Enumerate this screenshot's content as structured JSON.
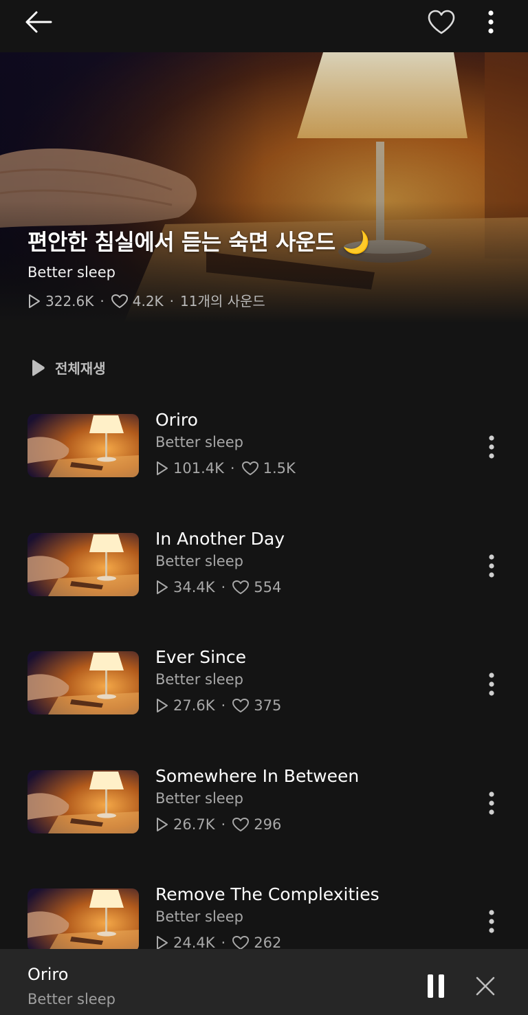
{
  "header": {
    "back_icon": "arrow-left-icon",
    "favorite_icon": "heart-outline-icon",
    "more_icon": "more-vertical-icon"
  },
  "playlist": {
    "title": "편안한 침실에서 듣는 숙면 사운드",
    "title_emoji": "🌙",
    "artist": "Better sleep",
    "plays": "322.6K",
    "likes": "4.2K",
    "separator": "·",
    "sound_count": "11개의 사운드"
  },
  "play_all": {
    "label": "전체재생",
    "icon": "play-icon"
  },
  "tracks": [
    {
      "title": "Oriro",
      "artist": "Better sleep",
      "plays": "101.4K",
      "likes": "1.5K"
    },
    {
      "title": "In Another Day",
      "artist": "Better sleep",
      "plays": "34.4K",
      "likes": "554"
    },
    {
      "title": "Ever Since",
      "artist": "Better sleep",
      "plays": "27.6K",
      "likes": "375"
    },
    {
      "title": "Somewhere In Between",
      "artist": "Better sleep",
      "plays": "26.7K",
      "likes": "296"
    },
    {
      "title": "Remove The Complexities",
      "artist": "Better sleep",
      "plays": "24.4K",
      "likes": "262"
    }
  ],
  "mini_player": {
    "title": "Oriro",
    "artist": "Better sleep",
    "pause_icon": "pause-icon",
    "close_icon": "close-icon"
  },
  "colors": {
    "background": "#141414",
    "mini_player_bg": "#262626",
    "lamp_glow": "#f2a640"
  }
}
